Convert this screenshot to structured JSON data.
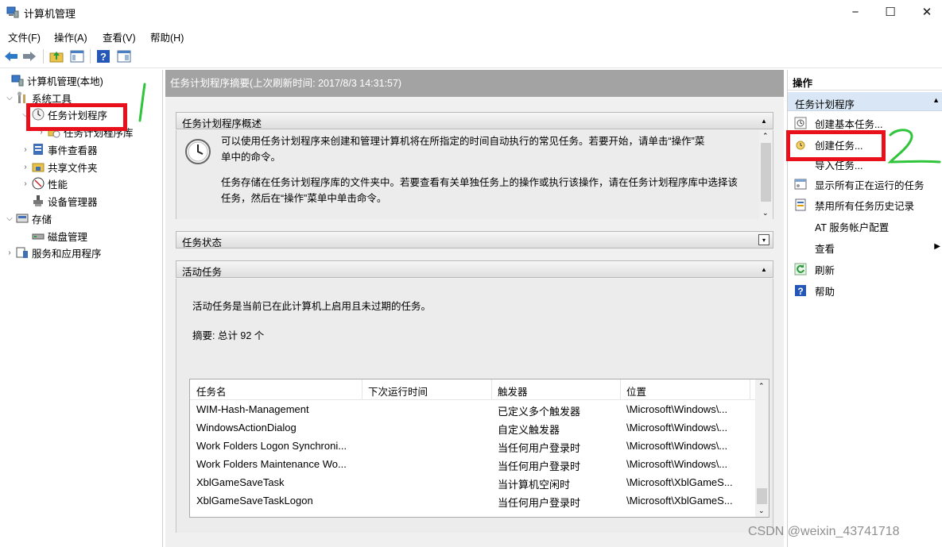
{
  "window": {
    "title": "计算机管理",
    "controls": [
      "−",
      "☐",
      "✕"
    ]
  },
  "menu": [
    "文件(F)",
    "操作(A)",
    "查看(V)",
    "帮助(H)"
  ],
  "tree": [
    {
      "label": "计算机管理(本地)",
      "icon": "computer-management-icon"
    },
    {
      "label": "系统工具",
      "icon": "tools-icon"
    },
    {
      "label": "任务计划程序",
      "icon": "clock-icon"
    },
    {
      "label": "任务计划程序库",
      "icon": "task-library-icon"
    },
    {
      "label": "事件查看器",
      "icon": "event-viewer-icon"
    },
    {
      "label": "共享文件夹",
      "icon": "shared-folder-icon"
    },
    {
      "label": "性能",
      "icon": "performance-icon"
    },
    {
      "label": "设备管理器",
      "icon": "device-manager-icon"
    },
    {
      "label": "存储",
      "icon": "storage-icon"
    },
    {
      "label": "磁盘管理",
      "icon": "disk-management-icon"
    },
    {
      "label": "服务和应用程序",
      "icon": "services-icon"
    }
  ],
  "center": {
    "header": "任务计划程序摘要(上次刷新时间: 2017/8/3 14:31:57)",
    "overview": {
      "title": "任务计划程序概述",
      "para1_line1": "可以使用任务计划程序来创建和管理计算机将在所指定的时间自动执行的常见任务。若要开始，请单击“操作”菜",
      "para1_line2": "单中的命令。",
      "para2_line1": "任务存储在任务计划程序库的文件夹中。若要查看有关单独任务上的操作或执行该操作，请在任务计划程序库中选择该",
      "para2_line2": "任务，然后在“操作”菜单中单击命令。"
    },
    "status": {
      "title": "任务状态"
    },
    "active": {
      "title": "活动任务",
      "desc": "活动任务是当前已在此计算机上启用且未过期的任务。",
      "summary": "摘要: 总计 92 个",
      "columns": [
        "任务名",
        "下次运行时间",
        "触发器",
        "位置"
      ],
      "rows": [
        [
          "WIM-Hash-Management",
          "",
          "已定义多个触发器",
          "\\Microsoft\\Windows\\..."
        ],
        [
          "WindowsActionDialog",
          "",
          "自定义触发器",
          "\\Microsoft\\Windows\\..."
        ],
        [
          "Work Folders Logon Synchroni...",
          "",
          "当任何用户登录时",
          "\\Microsoft\\Windows\\..."
        ],
        [
          "Work Folders Maintenance Wo...",
          "",
          "当任何用户登录时",
          "\\Microsoft\\Windows\\..."
        ],
        [
          "XblGameSaveTask",
          "",
          "当计算机空闲时",
          "\\Microsoft\\XblGameS..."
        ],
        [
          "XblGameSaveTaskLogon",
          "",
          "当任何用户登录时",
          "\\Microsoft\\XblGameS..."
        ]
      ]
    }
  },
  "actions": {
    "header": "操作",
    "subheader": "任务计划程序",
    "items": [
      {
        "label": "创建基本任务...",
        "icon": "create-basic-task-icon"
      },
      {
        "label": "创建任务...",
        "icon": "create-task-icon"
      },
      {
        "label": "导入任务...",
        "icon": ""
      },
      {
        "label": "显示所有正在运行的任务",
        "icon": "running-tasks-icon"
      },
      {
        "label": "禁用所有任务历史记录",
        "icon": "history-icon"
      },
      {
        "label": "AT 服务帐户配置",
        "icon": ""
      },
      {
        "label": "查看",
        "icon": ""
      },
      {
        "label": "刷新",
        "icon": "refresh-icon"
      },
      {
        "label": "帮助",
        "icon": "help-icon"
      }
    ]
  },
  "annotations": {
    "mark1": "1",
    "mark2": "2",
    "highlight_color": "#e8101a",
    "mark_color": "#2fc43a"
  },
  "watermark": "CSDN @weixin_43741718"
}
